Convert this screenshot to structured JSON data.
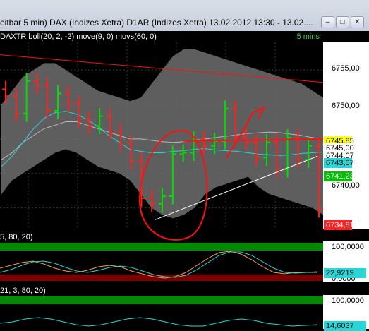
{
  "window": {
    "title": "eitbar 5 min)  DAX (Indizes Xetra) D1AR (Indizes Xetra) 13.02.2012 13:30 - 13.02....",
    "buttons": [
      "minimize",
      "restore",
      "close"
    ]
  },
  "main_chart": {
    "indicator_label": "DAXTR boll(20, 2, -2) move(9, 0) movs(60, 0)",
    "timeframe_label": "5 mins",
    "axis_ticks": [
      "6755,00",
      "6750,00",
      "6740,00"
    ],
    "price_tags": {
      "last_yellow": "6745,85",
      "red_line": "6745,00",
      "level_1": "6744,07",
      "cyan": "6743,07",
      "green": "6741,23",
      "low_red": "6734,81"
    }
  },
  "oscillator_1": {
    "label": "5, 80, 20)",
    "ticks": [
      "100,0000",
      "0,0000"
    ],
    "tag_value": "22,9219"
  },
  "oscillator_2": {
    "label": "21, 3, 80, 20)",
    "ticks": [
      "100,0000"
    ],
    "tag_value": "14,6037"
  },
  "colors": {
    "up_bar": "#00e000",
    "down_bar": "#ff2020",
    "band": "#6e6e6e",
    "ma_cyan": "#27d6d6",
    "ma_grey": "#b8b8b8",
    "annotation_red": "#ff1010",
    "osc_green": "#008a00",
    "osc_red": "#7a0000"
  },
  "chart_data": {
    "type": "line",
    "series": [
      {
        "values": [
          6751.2,
          6748.7,
          6753.4,
          6752.8,
          6749.1,
          6751.6,
          6750.1,
          6747.8,
          6746.9,
          6748.3,
          6746.0,
          6744.3,
          6741.8,
          6736.4,
          6735.6,
          6736.7,
          6742.8,
          6743.0,
          6744.9,
          6744.0,
          6744.7,
          6749.4,
          6745.3,
          6744.5,
          6742.3,
          6744.5,
          6740.6,
          6745.2,
          6742.0,
          6744.0,
          6734.8
        ]
      }
    ],
    "ylim": [
      6732,
      6759
    ]
  }
}
